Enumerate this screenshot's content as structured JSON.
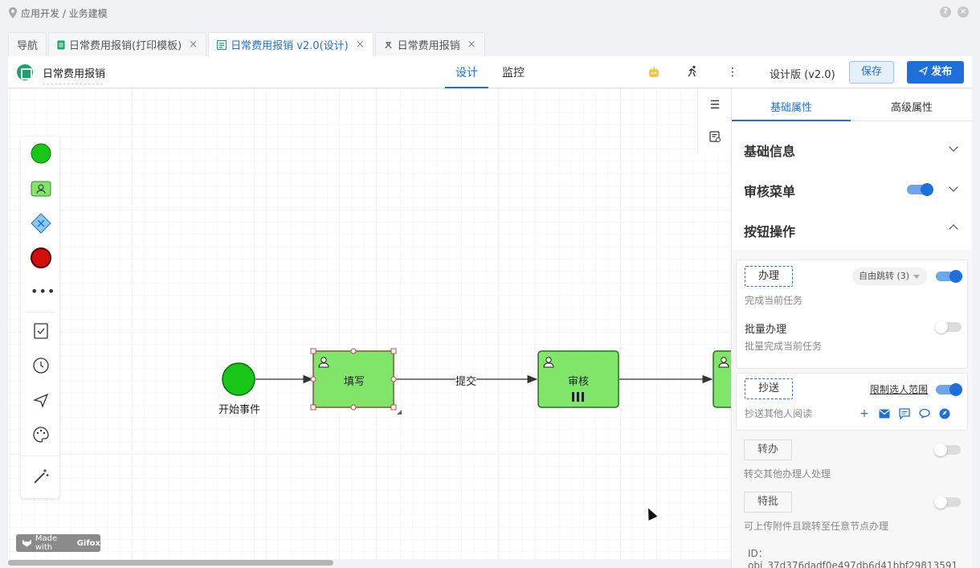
{
  "breadcrumb": "应用开发 / 业务建模",
  "tabs": [
    {
      "label": "导航",
      "icon": "none"
    },
    {
      "label": "日常费用报销(打印模板)",
      "icon": "doc-icon",
      "closable": true
    },
    {
      "label": "日常费用报销 v2.0(设计)",
      "icon": "form-icon",
      "closable": true,
      "active": true
    },
    {
      "label": "日常费用报销",
      "icon": "flow-icon",
      "closable": true
    }
  ],
  "header": {
    "title": "日常费用报销",
    "mode_tabs": [
      {
        "label": "设计",
        "active": true
      },
      {
        "label": "监控"
      }
    ],
    "version": "设计版 (v2.0)",
    "save_label": "保存",
    "publish_label": "发布"
  },
  "flow": {
    "start_label": "开始事件",
    "task1_label": "填写",
    "edge_label": "提交",
    "task2_label": "审核"
  },
  "panel": {
    "tab_basic": "基础属性",
    "tab_advanced": "高级属性",
    "sec_basic": "基础信息",
    "sec_audit": "审核菜单",
    "sec_buttons": "按钮操作",
    "handle": {
      "label": "办理",
      "desc": "完成当前任务",
      "select": "自由跳转 (3)"
    },
    "batch": {
      "label": "批量办理",
      "desc": "批量完成当前任务"
    },
    "cc": {
      "label": "抄送",
      "desc": "抄送其他人阅读",
      "link": "限制选人范围"
    },
    "transfer": {
      "label": "转办",
      "desc": "转交其他办理人处理"
    },
    "special": {
      "label": "特批",
      "desc": "可上传附件且跳转至任意节点办理"
    },
    "id_text": "ID：obj_37d376dadf0e497db6d41bbf29813591"
  },
  "watermark": {
    "prefix": "Made with",
    "brand": "Gifox"
  },
  "colors": {
    "accent": "#1e6fd9",
    "task_fill": "#7fe66a",
    "start_fill": "#17c617",
    "end_fill": "#d10d0d"
  }
}
